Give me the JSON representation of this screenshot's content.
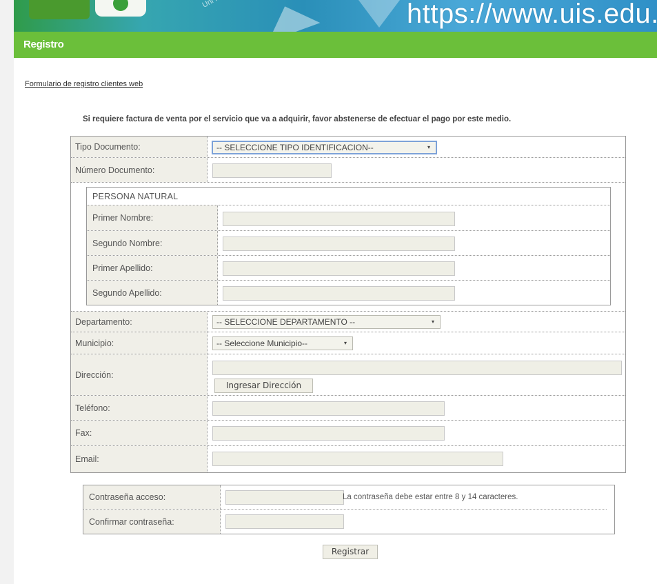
{
  "banner": {
    "url_text": "https://www.uis.edu.c",
    "watermark": "Uni Industr Santander"
  },
  "section": {
    "title": "Registro"
  },
  "form": {
    "link_text": "Formulario de registro clientes web",
    "notice": "Si requiere factura de venta por el servicio que va a adquirir, favor abstenerse de efectuar el pago por este medio.",
    "tipo_documento": {
      "label": "Tipo Documento:",
      "value": "-- SELECCIONE TIPO IDENTIFICACION--"
    },
    "numero_documento": {
      "label": "Número Documento:",
      "value": ""
    },
    "persona": {
      "title": "PERSONA NATURAL",
      "primer_nombre": "Primer Nombre:",
      "segundo_nombre": "Segundo Nombre:",
      "primer_apellido": "Primer Apellido:",
      "segundo_apellido": "Segundo Apellido:"
    },
    "departamento": {
      "label": "Departamento:",
      "value": "-- SELECCIONE DEPARTAMENTO --"
    },
    "municipio": {
      "label": "Municipio:",
      "value": "-- Seleccione Municipio--"
    },
    "direccion": {
      "label": "Dirección:",
      "button": "Ingresar Dirección"
    },
    "telefono": {
      "label": "Teléfono:"
    },
    "fax": {
      "label": "Fax:"
    },
    "email": {
      "label": "Email:"
    },
    "password": {
      "label": "Contraseña acceso:",
      "hint": "La contraseña debe estar entre 8 y 14 caracteres."
    },
    "confirm": {
      "label": "Confirmar contraseña:"
    },
    "submit": "Registrar"
  },
  "icons": {
    "dropdown": "▾"
  },
  "colors": {
    "section_bar": "#6bbf3a",
    "label_bg": "#f0efe8",
    "input_bg": "#efefe6"
  }
}
